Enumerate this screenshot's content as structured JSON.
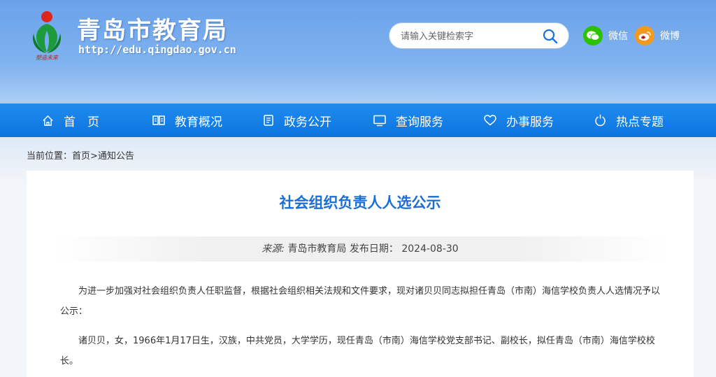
{
  "header": {
    "site_title": "青岛市教育局",
    "site_url": "http://edu.qingdao.gov.cn",
    "logo_caption": "塑造未来"
  },
  "search": {
    "placeholder": "请输入关键检索字",
    "icon": "search-icon"
  },
  "social": {
    "wechat_label": "微信",
    "weibo_label": "微博"
  },
  "nav": {
    "items": [
      {
        "label": "首　页",
        "icon": "home-icon"
      },
      {
        "label": "教育概况",
        "icon": "book-icon"
      },
      {
        "label": "政务公开",
        "icon": "document-icon"
      },
      {
        "label": "查询服务",
        "icon": "monitor-icon"
      },
      {
        "label": "办事服务",
        "icon": "heart-icon"
      },
      {
        "label": "热点专题",
        "icon": "power-icon"
      }
    ]
  },
  "breadcrumb": {
    "prefix": "当前位置：",
    "home": "首页",
    "separator": ">",
    "current": "通知公告"
  },
  "article": {
    "title": "社会组织负责人人选公示",
    "source_label": "来源:",
    "source": "青岛市教育局",
    "date_label": "发布日期：",
    "date": "2024-08-30",
    "paragraph_1": "为进一步加强对社会组织负责人任职监督，根据社会组织相关法规和文件要求，现对诸贝贝同志拟担任青岛（市南）海信学校负责人人选情况予以公示：",
    "paragraph_2": "诸贝贝，女，1966年1月17日生，汉族，中共党员，大学学历，现任青岛（市南）海信学校党支部书记、副校长，拟任青岛（市南）海信学校校长。"
  },
  "colors": {
    "nav_bg": "#1581e8",
    "title_blue": "#1a6fd6",
    "wechat_green": "#2dc100",
    "weibo_orange": "#f39a1e"
  }
}
